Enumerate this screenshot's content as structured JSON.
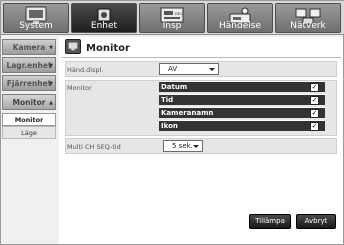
{
  "tabs": [
    {
      "label": "System",
      "icon": "monitor-icon",
      "active": false
    },
    {
      "label": "Enhet",
      "icon": "camera-icon",
      "active": true
    },
    {
      "label": "Insp",
      "icon": "record-icon",
      "active": false
    },
    {
      "label": "Händelse",
      "icon": "event-icon",
      "active": false
    },
    {
      "label": "Nätverk",
      "icon": "network-icon",
      "active": false
    }
  ],
  "sidebar": {
    "categories": [
      "Kamera",
      "Lagr.enhet",
      "Fjärrenhet",
      "Monitor"
    ],
    "subitems": [
      "Monitor",
      "Läge"
    ]
  },
  "main": {
    "title": "Monitor",
    "rows": {
      "hand_displ": {
        "label": "Händ.displ.",
        "value": "AV"
      },
      "monitor": {
        "label": "Monitor"
      },
      "seq": {
        "label": "Multi CH SEQ-tid",
        "value": "5 sek."
      }
    },
    "options": [
      {
        "label": "Datum",
        "checked": true
      },
      {
        "label": "Tid",
        "checked": true
      },
      {
        "label": "Kameranamn",
        "checked": true
      },
      {
        "label": "Ikon",
        "checked": true
      }
    ]
  },
  "buttons": {
    "apply": "Tillämpa",
    "cancel": "Avbryt"
  },
  "check_glyph": "✓"
}
